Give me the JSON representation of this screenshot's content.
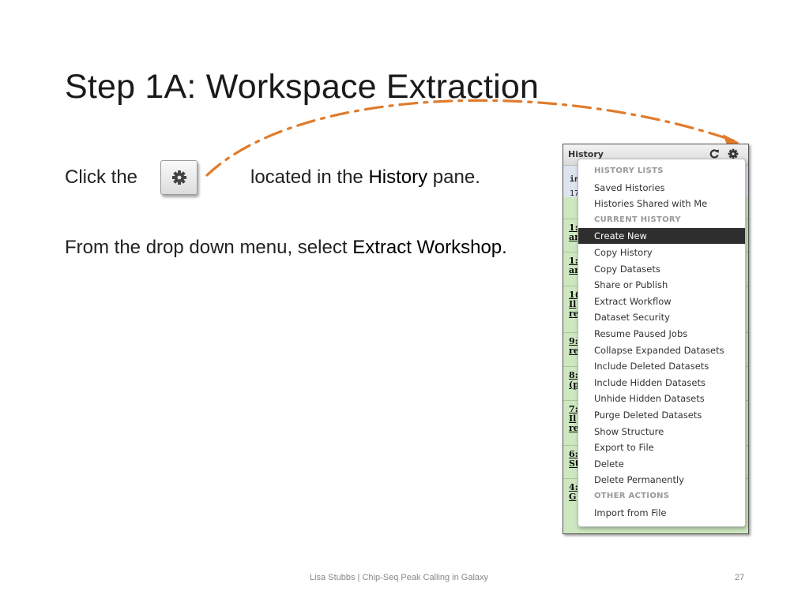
{
  "slide": {
    "title": "Step 1A: Workspace Extraction",
    "line1_pre": "Click the",
    "line1_post_a": "located in the",
    "line1_bold": "History",
    "line1_post_b": "pane.",
    "line2_pre": "From the drop down menu, select",
    "line2_bold": "Extract Workshop.",
    "gear_icon": "gear-icon",
    "arrow_color": "#e07b2b"
  },
  "history": {
    "title": "History",
    "name_partial": "in",
    "count_partial": "17",
    "row_labels": [
      [
        "1:",
        "ar"
      ],
      [
        "1:",
        "ar"
      ],
      [
        "1(",
        "Il",
        "re"
      ],
      [
        "9:",
        "re"
      ],
      [
        "8:",
        "(p"
      ],
      [
        "7:",
        "Il",
        "re"
      ],
      [
        "6:",
        "St"
      ],
      [
        "4:",
        "G"
      ]
    ],
    "row_color": "#cde8c0"
  },
  "menu": {
    "sections": [
      {
        "header": "HISTORY LISTS",
        "items": [
          "Saved Histories",
          "Histories Shared with Me"
        ]
      },
      {
        "header": "CURRENT HISTORY",
        "items": [
          "Create New",
          "Copy History",
          "Copy Datasets",
          "Share or Publish",
          "Extract Workflow",
          "Dataset Security",
          "Resume Paused Jobs",
          "Collapse Expanded Datasets",
          "Include Deleted Datasets",
          "Include Hidden Datasets",
          "Unhide Hidden Datasets",
          "Purge Deleted Datasets",
          "Show Structure",
          "Export to File",
          "Delete",
          "Delete Permanently"
        ]
      },
      {
        "header": "OTHER ACTIONS",
        "items": [
          "Import from File"
        ]
      }
    ],
    "highlighted": "Create New"
  },
  "footer": {
    "text": "Lisa Stubbs | Chip-Seq Peak Calling in Galaxy",
    "page": "27"
  }
}
